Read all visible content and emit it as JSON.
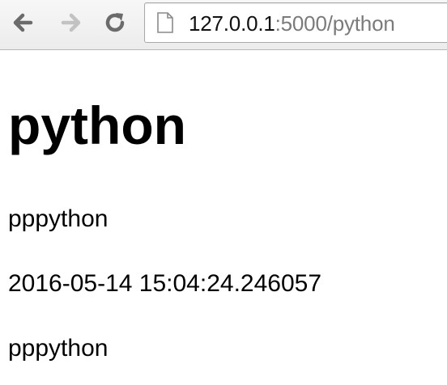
{
  "browser": {
    "toolbar": {
      "back_icon": "arrow-left-icon",
      "forward_icon": "arrow-right-icon",
      "reload_icon": "reload-icon"
    },
    "address_bar": {
      "page_icon": "page-icon",
      "url_host": "127.0.0.1",
      "url_rest": ":5000/python"
    }
  },
  "page": {
    "heading": "python",
    "paragraphs": [
      "pppython",
      "2016-05-14 15:04:24.246057",
      "pppython"
    ]
  },
  "colors": {
    "toolbar_bg": "#ececec",
    "icon_active": "#6b6b6b",
    "icon_disabled": "#c2c2c2",
    "url_host": "#111111",
    "url_path": "#7b7b7b",
    "text": "#000000"
  }
}
